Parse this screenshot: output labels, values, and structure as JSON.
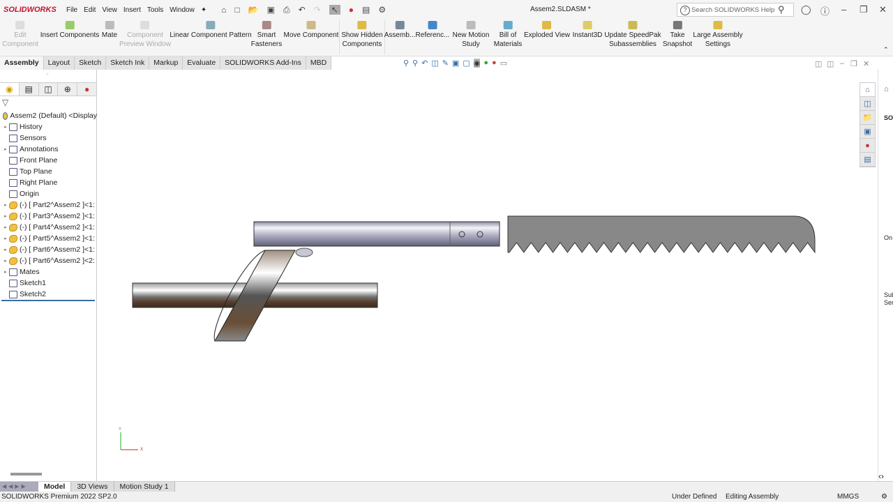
{
  "app": {
    "brand": "SOLIDWORKS",
    "doc_title": "Assem2.SLDASM *",
    "search_placeholder": "Search SOLIDWORKS Help"
  },
  "menu": [
    "File",
    "Edit",
    "View",
    "Insert",
    "Tools",
    "Window"
  ],
  "ribbon": [
    {
      "label": "Edit\nComponent",
      "disabled": true
    },
    {
      "label": "Insert Components"
    },
    {
      "label": "Mate"
    },
    {
      "label": "Component\nPreview Window",
      "disabled": true
    },
    {
      "label": "Linear Component Pattern"
    },
    {
      "label": "Smart\nFasteners"
    },
    {
      "label": "Move Component"
    },
    {
      "label": "Show Hidden\nComponents"
    },
    {
      "label": "Assemb..."
    },
    {
      "label": "Referenc..."
    },
    {
      "label": "New Motion\nStudy"
    },
    {
      "label": "Bill of\nMaterials"
    },
    {
      "label": "Exploded View"
    },
    {
      "label": "Instant3D"
    },
    {
      "label": "Update SpeedPak\nSubassemblies"
    },
    {
      "label": "Take\nSnapshot"
    },
    {
      "label": "Large Assembly\nSettings"
    }
  ],
  "tabs": [
    "Assembly",
    "Layout",
    "Sketch",
    "Sketch Ink",
    "Markup",
    "Evaluate",
    "SOLIDWORKS Add-Ins",
    "MBD"
  ],
  "tree": [
    {
      "label": "Assem2 (Default) <Display",
      "icon": "assembly-icon"
    },
    {
      "label": "History",
      "icon": "history-folder-icon",
      "expand": true
    },
    {
      "label": "Sensors",
      "icon": "sensors-folder-icon"
    },
    {
      "label": "Annotations",
      "icon": "annotations-folder-icon",
      "expand": true
    },
    {
      "label": "Front Plane",
      "icon": "plane-icon"
    },
    {
      "label": "Top Plane",
      "icon": "plane-icon"
    },
    {
      "label": "Right Plane",
      "icon": "plane-icon"
    },
    {
      "label": "Origin",
      "icon": "origin-icon"
    },
    {
      "label": "(-) [ Part2^Assem2 ]<1:",
      "icon": "part-icon",
      "expand": true
    },
    {
      "label": "(-) [ Part3^Assem2 ]<1:",
      "icon": "part-icon",
      "expand": true
    },
    {
      "label": "(-) [ Part4^Assem2 ]<1:",
      "icon": "part-icon",
      "expand": true
    },
    {
      "label": "(-) [ Part5^Assem2 ]<1:",
      "icon": "part-icon",
      "expand": true
    },
    {
      "label": "(-) [ Part6^Assem2 ]<1:",
      "icon": "part-icon",
      "expand": true
    },
    {
      "label": "(-) [ Part6^Assem2 ]<2:",
      "icon": "part-icon",
      "expand": true
    },
    {
      "label": "Mates",
      "icon": "mates-icon",
      "expand": true
    },
    {
      "label": "Sketch1",
      "icon": "sketch-icon"
    },
    {
      "label": "Sketch2",
      "icon": "sketch-icon"
    }
  ],
  "task_pane": {
    "sections": [
      "SOI",
      "On",
      "Sub",
      "Serv"
    ]
  },
  "axes": {
    "y": "Y",
    "x": "X"
  },
  "bottom_tabs": [
    "Model",
    "3D Views",
    "Motion Study 1"
  ],
  "status": {
    "product": "SOLIDWORKS Premium 2022 SP2.0",
    "state": "Under Defined",
    "mode": "Editing Assembly",
    "units": "MMGS"
  }
}
